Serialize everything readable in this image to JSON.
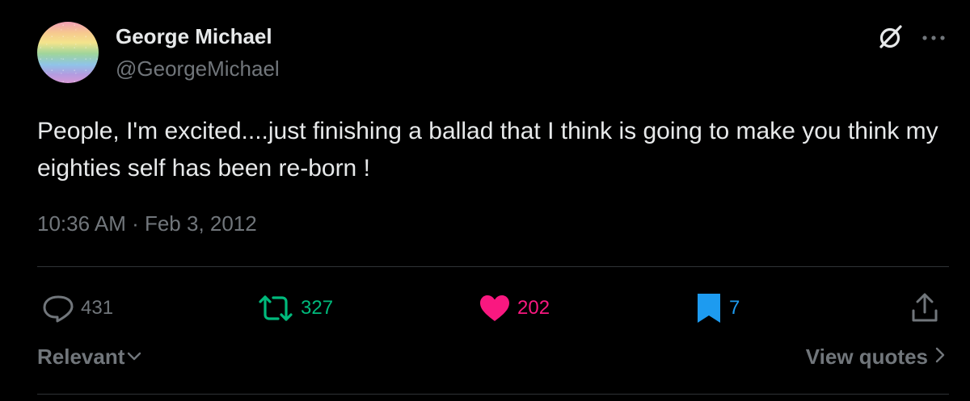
{
  "author": {
    "name": "George Michael",
    "handle": "@GeorgeMichael"
  },
  "tweet": {
    "text": "People, I'm excited....just finishing a ballad that I think is going to make you think my eighties self has been re-born !",
    "timestamp": "10:36 AM · Feb 3, 2012"
  },
  "actions": {
    "reply_count": "431",
    "retweet_count": "327",
    "like_count": "202",
    "bookmark_count": "7"
  },
  "footer": {
    "sort_label": "Relevant",
    "view_quotes_label": "View quotes"
  },
  "colors": {
    "background": "#000000",
    "text": "#e7e9ea",
    "muted": "#71767b",
    "retweet": "#00ba7c",
    "like": "#f91880",
    "bookmark": "#1d9bf0",
    "divider": "#2f3336"
  },
  "icons": {
    "header": [
      "grok-icon",
      "more-icon"
    ],
    "actions": [
      "reply-icon",
      "retweet-icon",
      "heart-icon",
      "bookmark-icon",
      "share-icon"
    ],
    "footer": [
      "chevron-down-icon",
      "chevron-right-icon"
    ]
  }
}
